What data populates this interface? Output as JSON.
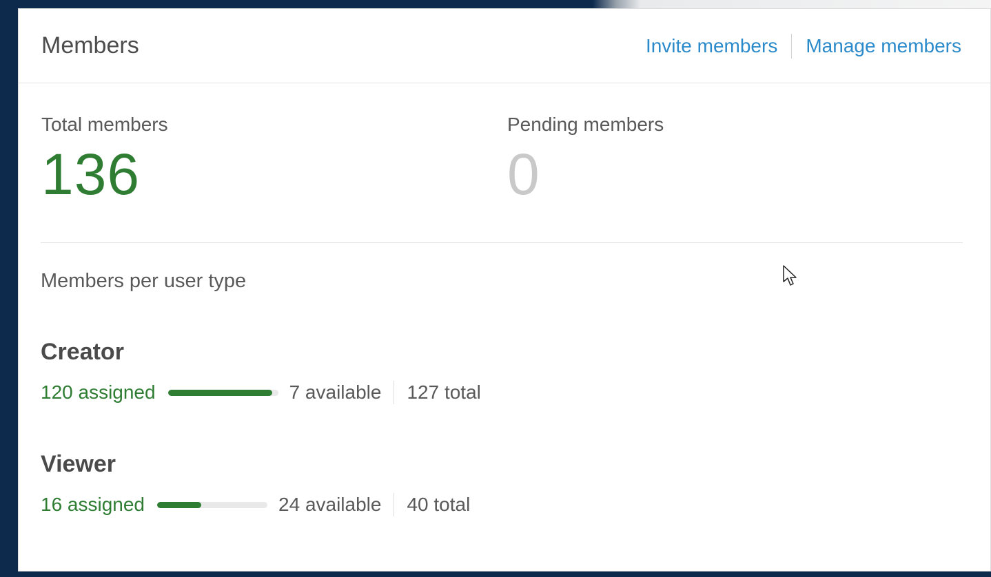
{
  "header": {
    "title": "Members",
    "links": {
      "invite": "Invite members",
      "manage": "Manage members"
    }
  },
  "stats": {
    "total": {
      "label": "Total members",
      "value": "136"
    },
    "pending": {
      "label": "Pending members",
      "value": "0"
    }
  },
  "user_types": {
    "section_label": "Members per user type",
    "items": [
      {
        "name": "Creator",
        "assigned": "120 assigned",
        "available": "7 available",
        "total": "127 total",
        "fill_fraction": 0.945
      },
      {
        "name": "Viewer",
        "assigned": "16 assigned",
        "available": "24 available",
        "total": "40 total",
        "fill_fraction": 0.4
      }
    ]
  },
  "colors": {
    "accent_green": "#2e7d32",
    "link_blue": "#2b8ac9",
    "background": "#0d2a4d"
  },
  "icons": {
    "cursor": "mouse-pointer-icon"
  }
}
